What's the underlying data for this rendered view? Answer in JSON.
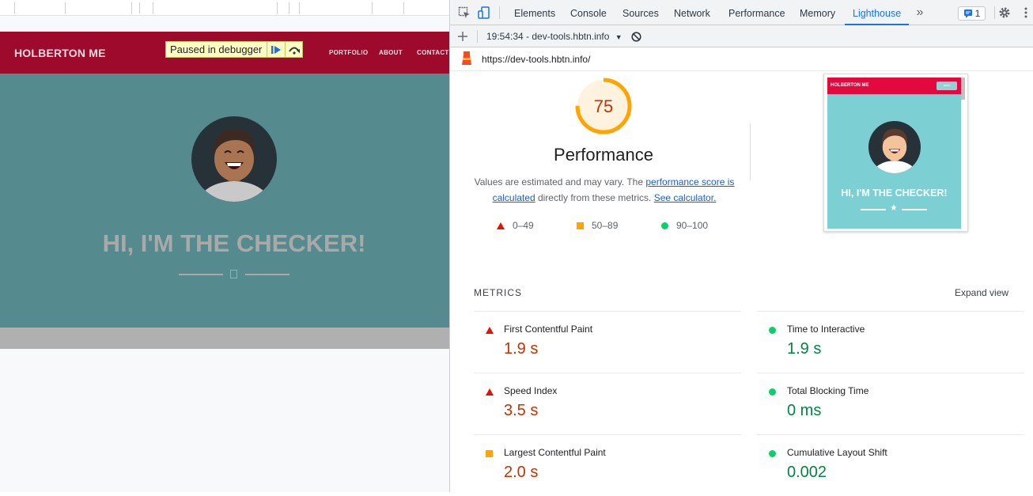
{
  "page": {
    "brand": "HOLBERTON ME",
    "nav_links": [
      "PORTFOLIO",
      "ABOUT",
      "CONTACT"
    ],
    "debugger_banner": "Paused in debugger",
    "hero_title": "HI, I'M THE CHECKER!"
  },
  "devtools": {
    "tabs": [
      "Elements",
      "Console",
      "Sources",
      "Network",
      "Performance",
      "Memory",
      "Lighthouse"
    ],
    "active_tab": "Lighthouse",
    "more_tabs_icon": "chevrons-right-icon",
    "issues_count": "1",
    "report_selector": "19:54:34 - dev-tools.hbtn.info",
    "report_url": "https://dev-tools.hbtn.info/"
  },
  "lighthouse": {
    "score": "75",
    "score_fraction": 0.75,
    "category_title": "Performance",
    "desc_prefix": "Values are estimated and may vary. The ",
    "desc_link1": "performance score is calculated",
    "desc_middle": " directly from these metrics. ",
    "desc_link2": "See calculator.",
    "legend": [
      {
        "shape": "triangle",
        "range": "0–49",
        "color": "#eb0f00"
      },
      {
        "shape": "square",
        "range": "50–89",
        "color": "#ffa400"
      },
      {
        "shape": "circle",
        "range": "90–100",
        "color": "#0cce6b"
      }
    ],
    "thumbnail": {
      "brand": "HOLBERTON ME",
      "menu_button": "MENU",
      "title": "HI, I'M THE CHECKER!"
    },
    "metrics_heading": "METRICS",
    "expand_view": "Expand view",
    "metrics": [
      {
        "label": "First Contentful Paint",
        "value": "1.9 s",
        "rating": "fail"
      },
      {
        "label": "Time to Interactive",
        "value": "1.9 s",
        "rating": "pass"
      },
      {
        "label": "Speed Index",
        "value": "3.5 s",
        "rating": "fail"
      },
      {
        "label": "Total Blocking Time",
        "value": "0 ms",
        "rating": "pass"
      },
      {
        "label": "Largest Contentful Paint",
        "value": "2.0 s",
        "rating": "average"
      },
      {
        "label": "Cumulative Layout Shift",
        "value": "0.002",
        "rating": "pass"
      }
    ]
  }
}
